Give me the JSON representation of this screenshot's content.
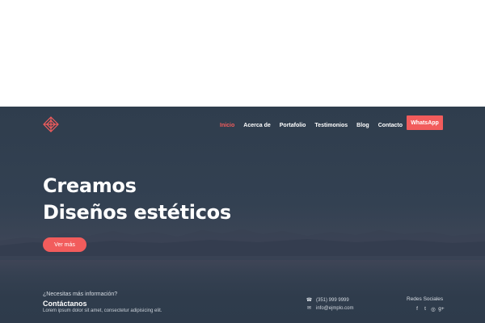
{
  "colors": {
    "accent": "#f25c5c",
    "hero_bg": "#334152",
    "text_light": "#ffffff"
  },
  "header": {
    "logo_icon": "diamond-logo-icon",
    "nav": [
      {
        "label": "Inicio",
        "active": true
      },
      {
        "label": "Acerca de",
        "active": false
      },
      {
        "label": "Portafolio",
        "active": false
      },
      {
        "label": "Testimonios",
        "active": false
      },
      {
        "label": "Blog",
        "active": false
      },
      {
        "label": "Contacto",
        "active": false
      }
    ],
    "cta_label": "WhatsApp"
  },
  "hero": {
    "headline_line1": "Creamos",
    "headline_line2": "Diseños estéticos",
    "button_label": "Ver más"
  },
  "footer": {
    "question": "¿Necesitas más información?",
    "title": "Contáctanos",
    "text": "Lorem ipsum dolor sit amet, consectetur adipisicing elit.",
    "phone": "(351) 999 9999",
    "email": "info@ejmplo.com",
    "phone_icon": "phone-icon",
    "email_icon": "envelope-icon",
    "social_title": "Redes Sociales",
    "social": [
      {
        "icon": "facebook-icon",
        "glyph": "f"
      },
      {
        "icon": "twitter-icon",
        "glyph": "t"
      },
      {
        "icon": "instagram-icon",
        "glyph": "◎"
      },
      {
        "icon": "google-plus-icon",
        "glyph": "g+"
      }
    ]
  }
}
